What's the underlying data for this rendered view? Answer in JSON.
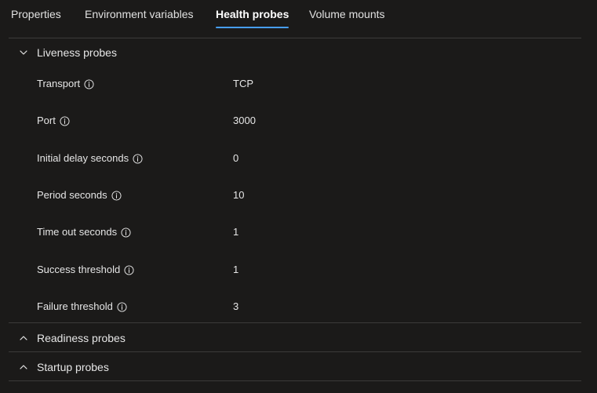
{
  "tabs": [
    {
      "label": "Properties",
      "active": false
    },
    {
      "label": "Environment variables",
      "active": false
    },
    {
      "label": "Health probes",
      "active": true
    },
    {
      "label": "Volume mounts",
      "active": false
    }
  ],
  "liveness": {
    "title": "Liveness probes",
    "expanded": true,
    "rows": [
      {
        "label": "Transport",
        "value": "TCP"
      },
      {
        "label": "Port",
        "value": "3000"
      },
      {
        "label": "Initial delay seconds",
        "value": "0"
      },
      {
        "label": "Period seconds",
        "value": "10"
      },
      {
        "label": "Time out seconds",
        "value": "1"
      },
      {
        "label": "Success threshold",
        "value": "1"
      },
      {
        "label": "Failure threshold",
        "value": "3"
      }
    ]
  },
  "readiness": {
    "title": "Readiness probes",
    "expanded": false
  },
  "startup": {
    "title": "Startup probes",
    "expanded": false
  },
  "colors": {
    "background": "#1b1a19",
    "text": "#e6e6e6",
    "accent": "#479ef5",
    "divider": "#3b3a39"
  },
  "icons": {
    "info": "info-icon",
    "chevron_down": "chevron-down-icon",
    "chevron_up": "chevron-up-icon"
  }
}
